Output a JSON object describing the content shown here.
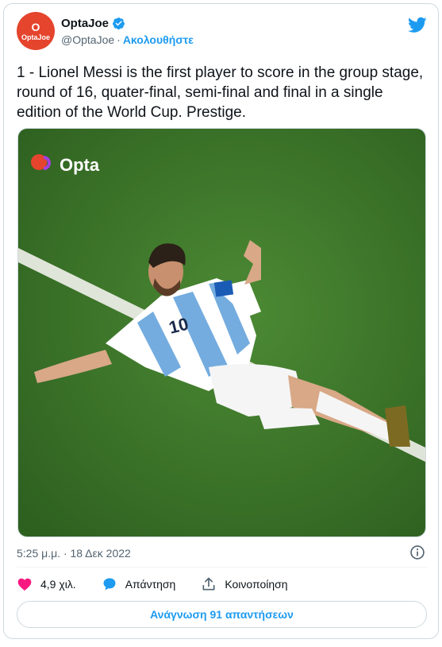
{
  "author": {
    "display_name": "OptaJoe",
    "handle": "@OptaJoe",
    "separator": "·",
    "follow_label": "Ακολουθήστε",
    "avatar_glyph": "O",
    "avatar_text": "OptaJoe",
    "verified": true
  },
  "tweet": {
    "text": "1 - Lionel Messi is the first player to score in the group stage, round of 16, quater-final, semi-final and final in a single edition of the World Cup. Prestige.",
    "timestamp": "5:25 μ.μ. · 18 Δεκ 2022"
  },
  "media": {
    "watermark": "Opta",
    "jersey_number": "10",
    "description_icon": "photo"
  },
  "actions": {
    "likes": "4,9 χιλ.",
    "reply_label": "Απάντηση",
    "share_label": "Κοινοποίηση",
    "read_replies_label": "Ανάγνωση 91 απαντήσεων"
  },
  "colors": {
    "accent": "#1d9bf0",
    "like": "#f91880",
    "avatar_bg": "#e5442d",
    "pitch": "#3f7a2c"
  },
  "icons": {
    "platform": "twitter-bird-icon",
    "verified": "verified-badge-icon",
    "info": "info-icon",
    "like": "heart-icon",
    "reply": "reply-bubble-icon",
    "share": "share-icon"
  }
}
